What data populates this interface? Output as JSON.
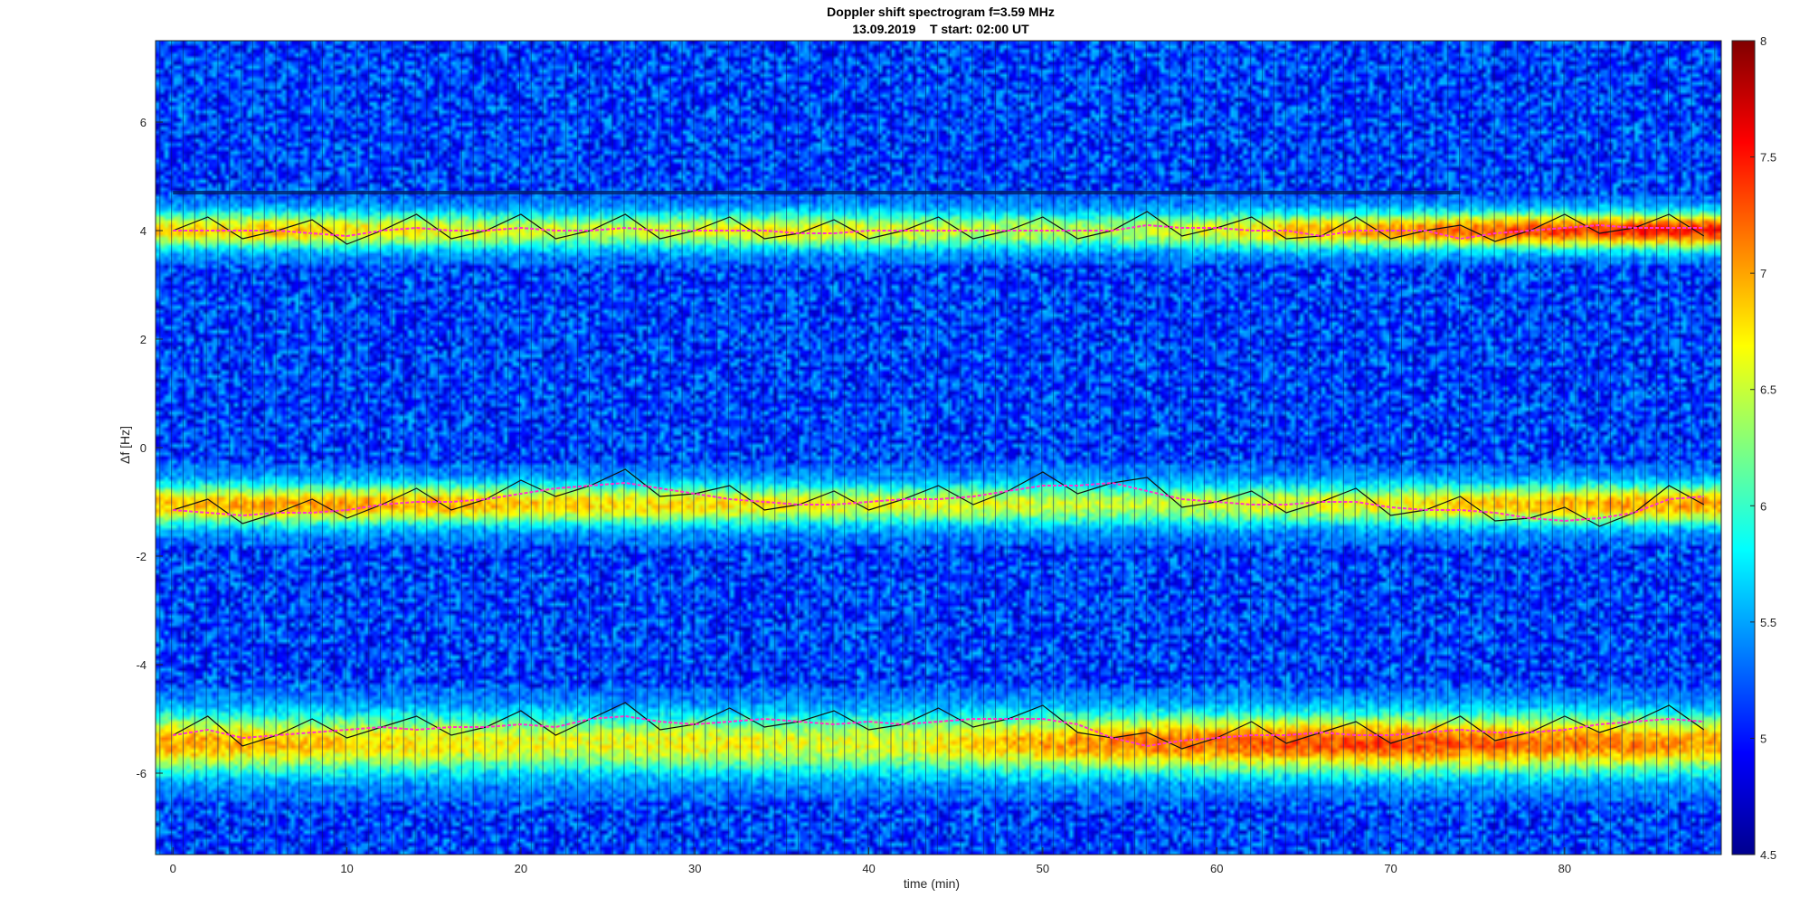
{
  "chart_data": {
    "type": "heatmap",
    "title": "Doppler shift spectrogram f=3.59 MHz",
    "subtitle": "13.09.2019    T start: 02:00 UT",
    "xlabel": "time (min)",
    "ylabel": "Δf [Hz]",
    "xlim": [
      -1,
      89
    ],
    "ylim": [
      -7.5,
      7.5
    ],
    "x_ticks": [
      0,
      10,
      20,
      30,
      40,
      50,
      60,
      70,
      80
    ],
    "y_ticks": [
      -6,
      -4,
      -2,
      0,
      2,
      4,
      6
    ],
    "colorbar": {
      "range": [
        4.5,
        8
      ],
      "ticks": [
        4.5,
        5,
        5.5,
        6,
        6.5,
        7,
        7.5,
        8
      ],
      "colormap": "jet"
    },
    "traces": [
      {
        "x": [
          0,
          2,
          4,
          6,
          8,
          10,
          12,
          14,
          16,
          18,
          20,
          22,
          24,
          26,
          28,
          30,
          32,
          34,
          36,
          38,
          40,
          42,
          44,
          46,
          48,
          50,
          52,
          54,
          56,
          58,
          60,
          62,
          64,
          66,
          68,
          70,
          72,
          74,
          76,
          78,
          80,
          82,
          84,
          86,
          88
        ],
        "y": [
          4.0,
          4.0,
          4.0,
          4.0,
          3.95,
          3.9,
          4.0,
          4.05,
          4.0,
          4.0,
          4.05,
          4.0,
          4.0,
          4.05,
          4.0,
          4.0,
          4.0,
          4.0,
          3.95,
          3.95,
          4.0,
          4.0,
          4.0,
          4.0,
          4.0,
          4.0,
          4.0,
          4.0,
          4.1,
          4.05,
          4.05,
          4.0,
          4.0,
          3.9,
          4.0,
          4.0,
          4.0,
          3.85,
          3.95,
          4.0,
          4.05,
          4.1,
          4.05,
          4.05,
          4.05
        ]
      },
      {
        "x": [
          0,
          2,
          4,
          6,
          8,
          10,
          12,
          14,
          16,
          18,
          20,
          22,
          24,
          26,
          28,
          30,
          32,
          34,
          36,
          38,
          40,
          42,
          44,
          46,
          48,
          50,
          52,
          54,
          56,
          58,
          60,
          62,
          64,
          66,
          68,
          70,
          72,
          74,
          76,
          78,
          80,
          82,
          84,
          86,
          88
        ],
        "y": [
          -1.15,
          -1.2,
          -1.25,
          -1.2,
          -1.2,
          -1.15,
          -1.05,
          -1.0,
          -1.0,
          -0.95,
          -0.85,
          -0.75,
          -0.7,
          -0.65,
          -0.75,
          -0.85,
          -0.95,
          -1.0,
          -1.05,
          -1.05,
          -1.0,
          -0.95,
          -0.95,
          -0.9,
          -0.8,
          -0.7,
          -0.7,
          -0.65,
          -0.8,
          -0.95,
          -1.0,
          -1.05,
          -1.05,
          -1.0,
          -1.0,
          -1.1,
          -1.15,
          -1.15,
          -1.2,
          -1.3,
          -1.35,
          -1.3,
          -1.2,
          -0.95,
          -0.9
        ]
      },
      {
        "x": [
          0,
          2,
          4,
          6,
          8,
          10,
          12,
          14,
          16,
          18,
          20,
          22,
          24,
          26,
          28,
          30,
          32,
          34,
          36,
          38,
          40,
          42,
          44,
          46,
          48,
          50,
          52,
          54,
          56,
          58,
          60,
          62,
          64,
          66,
          68,
          70,
          72,
          74,
          76,
          78,
          80,
          82,
          84,
          86,
          88
        ],
        "y": [
          -5.3,
          -5.2,
          -5.35,
          -5.3,
          -5.25,
          -5.2,
          -5.15,
          -5.2,
          -5.15,
          -5.15,
          -5.1,
          -5.15,
          -5.0,
          -4.95,
          -5.05,
          -5.1,
          -5.05,
          -5.0,
          -5.05,
          -5.1,
          -5.05,
          -5.1,
          -5.05,
          -5.0,
          -5.0,
          -5.0,
          -5.1,
          -5.35,
          -5.5,
          -5.4,
          -5.35,
          -5.3,
          -5.3,
          -5.25,
          -5.3,
          -5.3,
          -5.25,
          -5.2,
          -5.25,
          -5.25,
          -5.2,
          -5.1,
          -5.05,
          -5.0,
          -5.05
        ]
      }
    ],
    "bands": [
      {
        "y": [
          3.6,
          4.4
        ],
        "x": [
          0,
          89
        ],
        "intensity": [
          6.8,
          6.9,
          6.7,
          6.6,
          6.5,
          6.6,
          6.7,
          6.6,
          6.5,
          6.4,
          6.6,
          6.9,
          7.1,
          7.3,
          7.4,
          7.5
        ]
      },
      {
        "y": [
          -1.5,
          -0.6
        ],
        "x": [
          0,
          89
        ],
        "intensity": [
          6.9,
          7.0,
          7.0,
          6.9,
          6.8,
          6.8,
          6.7,
          6.6,
          6.6,
          6.5,
          6.5,
          6.6,
          6.7,
          6.9,
          7.0,
          7.0
        ]
      },
      {
        "y": [
          -6.1,
          -4.8
        ],
        "x": [
          0,
          89
        ],
        "intensity": [
          7.0,
          6.9,
          6.8,
          6.7,
          6.6,
          6.7,
          6.6,
          6.6,
          6.9,
          7.1,
          7.2,
          7.3,
          7.3,
          7.2,
          7.1,
          7.0
        ]
      }
    ],
    "horizontal_line": {
      "y": 4.7,
      "x": [
        0,
        74
      ]
    }
  }
}
